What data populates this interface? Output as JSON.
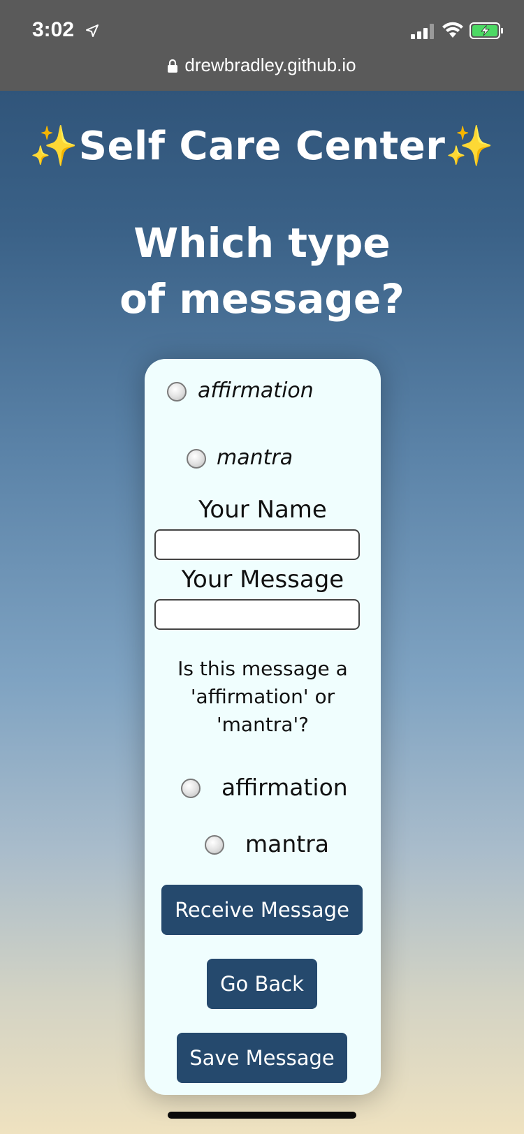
{
  "status_bar": {
    "time": "3:02",
    "url": "drewbradley.github.io",
    "icons": [
      "location-arrow-icon",
      "cellular-signal-icon",
      "wifi-icon",
      "battery-charging-icon",
      "lock-icon"
    ]
  },
  "header": {
    "sparkle_left": "✨",
    "title": "Self Care Center",
    "sparkle_right": "✨",
    "question": "Which type of message?"
  },
  "card": {
    "choice_options": [
      {
        "label": "affirmation"
      },
      {
        "label": "mantra"
      }
    ],
    "name_label": "Your Name",
    "name_value": "",
    "message_label": "Your Message",
    "message_value": "",
    "type_prompt": "Is this message a 'affirmation' or 'mantra'?",
    "type_options": [
      {
        "label": "affirmation"
      },
      {
        "label": "mantra"
      }
    ],
    "buttons": {
      "receive": "Receive Message",
      "back": "Go Back",
      "save": "Save Message"
    }
  },
  "colors": {
    "button_bg": "#25496d",
    "card_bg": "#f0fefe",
    "status_bar_bg": "#5a5a5a",
    "sparkle": "#f4d35e",
    "battery_fill": "#4cd964"
  }
}
